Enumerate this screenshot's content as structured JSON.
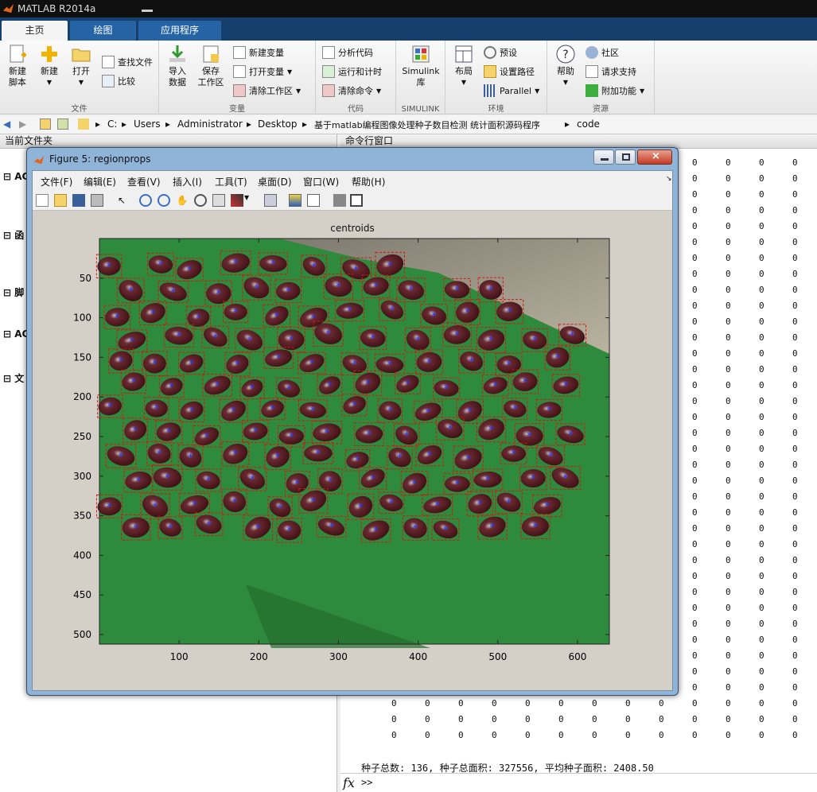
{
  "app": {
    "title": "MATLAB R2014a"
  },
  "tabs": [
    {
      "label": "主页"
    },
    {
      "label": "绘图"
    },
    {
      "label": "应用程序"
    }
  ],
  "ribbon": {
    "file": {
      "label": "文件",
      "new_script": "新建\n脚本",
      "new": "新建",
      "open": "打开",
      "find_files": "查找文件",
      "compare": "比较"
    },
    "variable": {
      "label": "变量",
      "import": "导入\n数据",
      "save_ws": "保存\n工作区",
      "new_var": "新建变量",
      "open_var": "打开变量",
      "clear_ws": "清除工作区"
    },
    "code": {
      "label": "代码",
      "analyze": "分析代码",
      "run_time": "运行和计时",
      "clear_cmd": "清除命令"
    },
    "simulink": {
      "label": "SIMULINK",
      "lib": "Simulink\n库"
    },
    "env": {
      "label": "环境",
      "layout": "布局",
      "prefs": "预设",
      "set_path": "设置路径",
      "parallel": "Parallel"
    },
    "resources": {
      "label": "资源",
      "help": "帮助",
      "community": "社区",
      "support": "请求支持",
      "addons": "附加功能"
    }
  },
  "address": {
    "segments": [
      "C:",
      "Users",
      "Administrator",
      "Desktop",
      "基于matlab编程图像处理种子数目检测 统计面积源码程序",
      "code"
    ]
  },
  "left_panel": {
    "header": "当前文件夹",
    "rows": [
      "AC",
      "函",
      "脚",
      "AC",
      "文"
    ]
  },
  "command": {
    "header": "命令行窗口",
    "zero": "0",
    "result": "种子总数: 136, 种子总面积: 327556, 平均种子面积: 2408.50",
    "prompt": ">>",
    "fx": "fx"
  },
  "figure": {
    "title": "Figure 5: regionprops",
    "menu": [
      "文件(F)",
      "编辑(E)",
      "查看(V)",
      "插入(I)",
      "工具(T)",
      "桌面(D)",
      "窗口(W)",
      "帮助(H)"
    ],
    "axes_title": "centroids",
    "xticks": [
      100,
      200,
      300,
      400,
      500,
      600
    ],
    "yticks": [
      50,
      100,
      150,
      200,
      250,
      300,
      350,
      400,
      450,
      500
    ],
    "xlim": [
      0,
      640
    ],
    "ylim": [
      0,
      512
    ],
    "accent_bbox": "#dd1111",
    "accent_centroid": "#2233ff"
  },
  "seeds": [
    [
      12,
      13
    ],
    [
      24,
      52
    ],
    [
      29,
      34
    ],
    [
      37,
      28
    ],
    [
      48,
      39
    ],
    [
      56,
      21
    ],
    [
      66,
      35
    ],
    [
      79,
      56
    ],
    [
      91,
      25
    ],
    [
      103,
      40
    ],
    [
      112,
      49
    ],
    [
      110,
      37
    ],
    [
      120,
      63
    ],
    [
      141,
      65
    ],
    [
      170,
      57
    ],
    [
      181,
      44
    ],
    [
      194,
      43
    ],
    [
      205,
      55
    ],
    [
      215,
      55
    ],
    [
      225,
      76
    ],
    [
      237,
      67
    ],
    [
      233,
      75
    ],
    [
      249,
      83
    ],
    [
      262,
      59
    ],
    [
      274,
      64
    ],
    [
      292,
      85
    ],
    [
      302,
      59
    ],
    [
      314,
      84
    ],
    [
      332,
      63
    ],
    [
      346,
      76
    ],
    [
      352,
      57
    ],
    [
      361,
      89
    ],
    [
      371,
      54
    ],
    [
      381,
      61
    ],
    [
      396,
      58
    ],
    [
      420,
      51
    ],
    [
      447,
      52
    ],
    [
      465,
      59
    ],
    [
      485,
      51
    ],
    [
      507,
      56
    ],
    [
      523,
      52
    ],
    [
      537,
      53
    ],
    [
      547,
      65
    ],
    [
      565,
      61
    ],
    [
      593,
      54
    ],
    [
      607,
      62
    ],
    [
      612,
      71
    ],
    [
      630,
      79
    ],
    [
      640,
      63
    ],
    [
      655,
      76
    ],
    [
      659,
      90
    ],
    [
      676,
      67
    ],
    [
      687,
      71
    ],
    [
      699,
      84
    ],
    [
      714,
      89
    ],
    [
      729,
      83
    ],
    [
      748,
      77
    ],
    [
      762,
      84
    ],
    [
      773,
      89
    ],
    [
      786,
      81
    ],
    [
      799,
      90
    ],
    [
      822,
      66
    ],
    [
      840,
      71
    ],
    [
      851,
      91
    ],
    [
      866,
      62
    ],
    [
      879,
      68
    ],
    [
      898,
      65
    ],
    [
      903,
      94
    ],
    [
      923,
      90
    ],
    [
      945,
      82
    ],
    [
      953,
      53
    ],
    [
      968,
      79
    ],
    [
      980,
      95
    ],
    [
      996,
      94
    ],
    [
      1009,
      86
    ],
    [
      1021,
      93
    ],
    [
      1046,
      95
    ],
    [
      1056,
      51
    ],
    [
      1069,
      55
    ],
    [
      1088,
      77
    ],
    [
      1104,
      83
    ],
    [
      1123,
      54
    ],
    [
      1136,
      71
    ],
    [
      1146,
      63
    ],
    [
      1152,
      95
    ],
    [
      1175,
      94
    ],
    [
      1184,
      75
    ],
    [
      1195,
      65
    ],
    [
      1209,
      76
    ],
    [
      1221,
      71
    ],
    [
      1231,
      68
    ],
    [
      1250,
      88
    ],
    [
      1268,
      93
    ],
    [
      1272,
      69
    ],
    [
      1296,
      51
    ],
    [
      1303,
      82
    ],
    [
      1324,
      93
    ],
    [
      1341,
      71
    ],
    [
      1350,
      88
    ],
    [
      1357,
      53
    ],
    [
      1368,
      63
    ],
    [
      1389,
      64
    ],
    [
      1391,
      86
    ],
    [
      1408,
      75
    ],
    [
      1417,
      70
    ],
    [
      1437,
      62
    ],
    [
      1441,
      62
    ],
    [
      1467,
      82
    ],
    [
      1467,
      68
    ],
    [
      1487,
      62
    ],
    [
      1500,
      69
    ],
    [
      1510,
      83
    ],
    [
      1512,
      60
    ],
    [
      1522,
      95
    ],
    [
      1541,
      72
    ],
    [
      1552,
      90
    ],
    [
      1563,
      71
    ],
    [
      1575,
      91
    ],
    [
      1593,
      69
    ],
    [
      1605,
      69
    ],
    [
      1619,
      87
    ],
    [
      1625,
      62
    ],
    [
      1648,
      53
    ],
    [
      1658,
      55
    ],
    [
      1676,
      65
    ],
    [
      1681,
      61
    ],
    [
      1695,
      59
    ],
    [
      1707,
      90
    ],
    [
      1728,
      74
    ],
    [
      1739,
      86
    ],
    [
      1745,
      72
    ],
    [
      1756,
      66
    ],
    [
      1775,
      89
    ],
    [
      1785,
      86
    ],
    [
      1801,
      85
    ],
    [
      1812,
      63
    ]
  ]
}
